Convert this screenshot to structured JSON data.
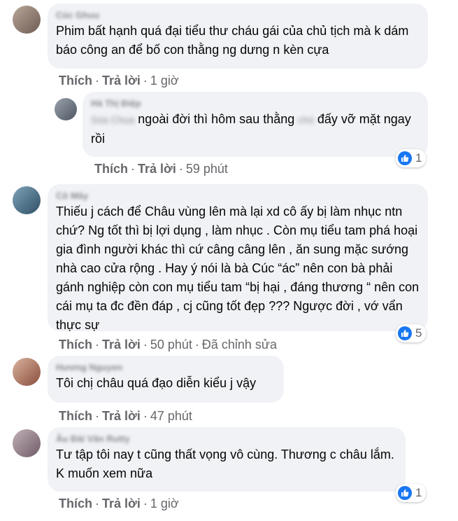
{
  "comments": [
    {
      "author": "Cúc Ghuu",
      "text": "Phim bất hạnh quá đại tiểu thư cháu gái của chủ tịch mà k dám báo công an để bố con thằng ng dưng n kèn cựa",
      "like_label": "Thích",
      "reply_label": "Trả lời",
      "time": "1 giờ"
    },
    {
      "author": "Hà Thị Điệp",
      "mention": "Sóa Chua",
      "text_a": "ngoài đời thì hôm sau thằng",
      "text_hidden": "chó",
      "text_b": "đấy vỡ mặt ngay rồi",
      "like_label": "Thích",
      "reply_label": "Trả lời",
      "time": "59 phút",
      "reaction_count": "1"
    },
    {
      "author": "Cô Mây",
      "text": "Thiếu j cách để Châu vùng lên mà lại xd cô ấy bị làm nhục ntn chứ? Ng tốt thì bị lợi dụng , làm nhục . Còn mụ tiểu tam phá hoại gia đình người khác thì cứ câng câng lên , ăn sung mặc sướng nhà cao cửa rộng . Hay ý nói là bà Cúc “ác” nên con bà phải gánh nghiệp còn con mụ tiểu tam “bị hại , đáng thương “ nên con cái mụ ta đc đền đáp , cj cũng tốt đẹp ??? Ngược đời , vớ vẩn thực sự",
      "like_label": "Thích",
      "reply_label": "Trả lời",
      "time": "50 phút",
      "edited": "Đã chỉnh sửa",
      "reaction_count": "5"
    },
    {
      "author": "Hương Nguyen",
      "text": "Tôi chị châu quá đạo diễn kiểu j vậy",
      "like_label": "Thích",
      "reply_label": "Trả lời",
      "time": "47 phút"
    },
    {
      "author": "Âu Đài Vân Rutty",
      "text": "Tư tập tôi nay t cũng thất vọng vô cùng. Thương c châu lắm. K muốn xem nữa",
      "like_label": "Thích",
      "reply_label": "Trả lời",
      "time": "1 giờ",
      "reaction_count": "1"
    }
  ],
  "colors": {
    "bubble": "#f0f2f5",
    "meta_text": "#65676b",
    "like_blue": "#1877f2"
  }
}
